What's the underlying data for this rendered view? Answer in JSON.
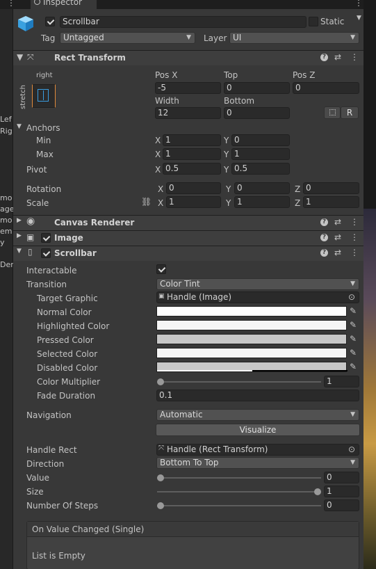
{
  "hierarchy_fragments": [
    "Lef",
    "Rig",
    "mo",
    "age",
    "mo",
    "em",
    "y",
    "Der"
  ],
  "tab": {
    "label": "Inspector"
  },
  "gameobject": {
    "name": "Scrollbar",
    "static_label": "Static",
    "tag_label": "Tag",
    "tag_value": "Untagged",
    "layer_label": "Layer",
    "layer_value": "UI"
  },
  "rect_transform": {
    "title": "Rect Transform",
    "anchor_preset_top": "right",
    "anchor_preset_side": "stretch",
    "pos_x_label": "Pos X",
    "pos_x": "-5",
    "top_label": "Top",
    "top": "0",
    "pos_z_label": "Pos Z",
    "pos_z": "0",
    "width_label": "Width",
    "width": "12",
    "bottom_label": "Bottom",
    "bottom": "0",
    "r_button": "R",
    "anchors_label": "Anchors",
    "min_label": "Min",
    "min_x": "1",
    "min_y": "0",
    "max_label": "Max",
    "max_x": "1",
    "max_y": "1",
    "pivot_label": "Pivot",
    "pivot_x": "0.5",
    "pivot_y": "0.5",
    "rotation_label": "Rotation",
    "rot_x": "0",
    "rot_y": "0",
    "rot_z": "0",
    "scale_label": "Scale",
    "scale_x": "1",
    "scale_y": "1",
    "scale_z": "1",
    "x": "X",
    "y": "Y",
    "z": "Z"
  },
  "canvas_renderer": {
    "title": "Canvas Renderer"
  },
  "image": {
    "title": "Image"
  },
  "scrollbar": {
    "title": "Scrollbar",
    "interactable_label": "Interactable",
    "transition_label": "Transition",
    "transition_value": "Color Tint",
    "target_graphic_label": "Target Graphic",
    "target_graphic_value": "Handle (Image)",
    "normal_color_label": "Normal Color",
    "highlighted_color_label": "Highlighted Color",
    "pressed_color_label": "Pressed Color",
    "selected_color_label": "Selected Color",
    "disabled_color_label": "Disabled Color",
    "color_multiplier_label": "Color Multiplier",
    "color_multiplier_value": "1",
    "fade_duration_label": "Fade Duration",
    "fade_duration_value": "0.1",
    "navigation_label": "Navigation",
    "navigation_value": "Automatic",
    "visualize_button": "Visualize",
    "handle_rect_label": "Handle Rect",
    "handle_rect_value": "Handle (Rect Transform)",
    "direction_label": "Direction",
    "direction_value": "Bottom To Top",
    "value_label": "Value",
    "value_value": "0",
    "size_label": "Size",
    "size_value": "1",
    "steps_label": "Number Of Steps",
    "steps_value": "0",
    "event_title": "On Value Changed (Single)",
    "event_empty": "List is Empty"
  },
  "colors": {
    "normal": "#ffffff",
    "highlighted": "#f5f5f5",
    "pressed": "#c8c8c8",
    "selected": "#f5f5f5",
    "disabled": "#c8c8c8"
  },
  "slider_levels": {
    "color_multiplier": 0.0,
    "value": 0.0,
    "size": 1.0,
    "steps": 0.0
  }
}
